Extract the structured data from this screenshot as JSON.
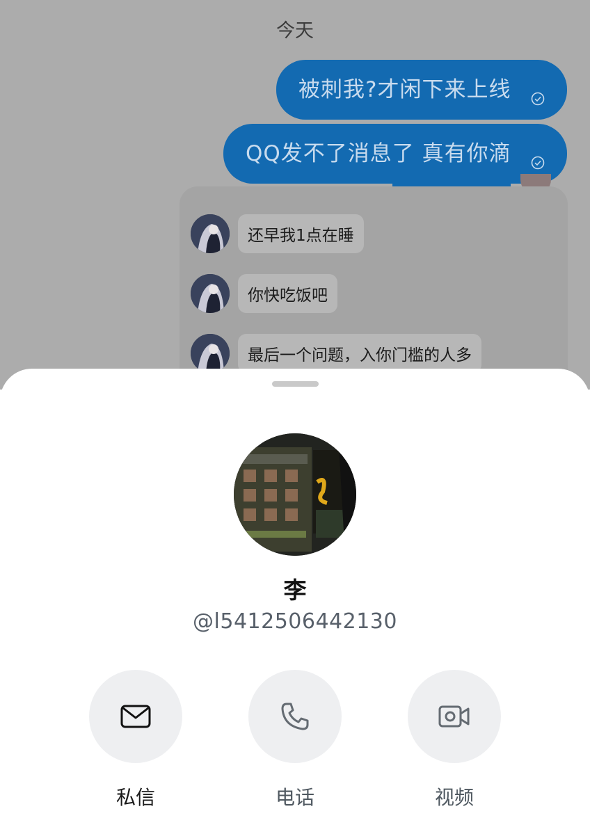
{
  "chat": {
    "date_label": "今天",
    "outgoing_messages": [
      {
        "text": "被刺我?才闲下来上线",
        "status": "sent-check-icon"
      },
      {
        "text": "QQ发不了消息了 真有你滴",
        "status": "sent-check-icon"
      }
    ],
    "forwarded_messages": [
      {
        "text": "还早我1点在睡"
      },
      {
        "text": "你快吃饭吧"
      },
      {
        "text": "最后一个问题，入你门槛的人多"
      }
    ]
  },
  "profile": {
    "name": "李",
    "handle": "@l5412506442130"
  },
  "actions": [
    {
      "label": "私信",
      "icon": "mail-icon"
    },
    {
      "label": "电话",
      "icon": "phone-icon"
    },
    {
      "label": "视频",
      "icon": "video-icon"
    }
  ],
  "colors": {
    "outgoing_bubble": "#136ab1",
    "overlay_background": "#acacac",
    "action_circle": "#eeeff1"
  }
}
